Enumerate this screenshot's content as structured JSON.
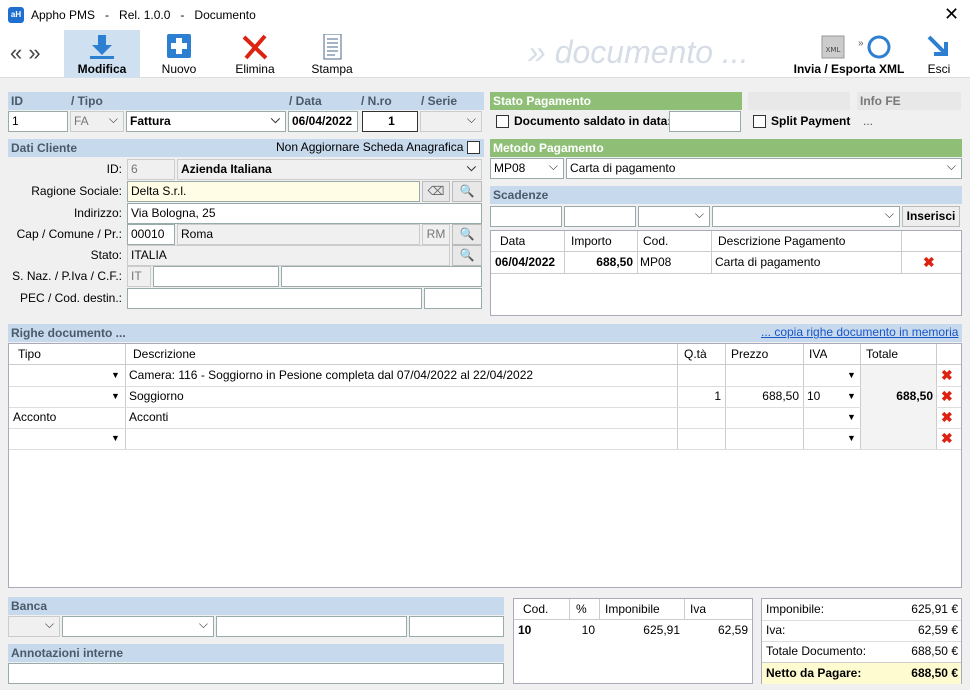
{
  "window": {
    "app": "Appho PMS",
    "release": "Rel. 1.0.0",
    "section": "Documento",
    "app_icon": "aH"
  },
  "toolbar": {
    "modifica": "Modifica",
    "nuovo": "Nuovo",
    "elimina": "Elimina",
    "stampa": "Stampa",
    "invia": "Invia / Esporta XML",
    "esci": "Esci",
    "watermark": "» documento ...",
    "xml_badge": "XML"
  },
  "doc": {
    "id_label": "ID",
    "tipo_label": "/ Tipo",
    "data_label": "/ Data",
    "nro_label": "/ N.ro",
    "serie_label": "/ Serie",
    "id": "1",
    "tipo_code": "FA",
    "tipo": "Fattura",
    "data": "06/04/2022",
    "nro": "1",
    "serie": ""
  },
  "cliente": {
    "title": "Dati Cliente",
    "no_update": "Non Aggiornare Scheda Anagrafica",
    "id_label": "ID:",
    "id": "6",
    "tipo": "Azienda Italiana",
    "ragione_label": "Ragione Sociale:",
    "ragione": "Delta S.r.l.",
    "indirizzo_label": "Indirizzo:",
    "indirizzo": "Via Bologna, 25",
    "cap_label": "Cap / Comune / Pr.:",
    "cap": "00010",
    "comune": "Roma",
    "pr": "RM",
    "stato_label": "Stato:",
    "stato": "ITALIA",
    "naz_label": "S. Naz. / P.Iva / C.F.:",
    "naz": "IT",
    "piva": "",
    "cf": "",
    "pec_label": "PEC / Cod. destin.:",
    "pec": "",
    "cod_dest": ""
  },
  "pagamento": {
    "stato_title": "Stato Pagamento",
    "saldato_label": "Documento saldato in data:",
    "saldato_data": "",
    "split": "Split Payment",
    "info_fe_title": "Info FE",
    "info_fe": "...",
    "metodo_title": "Metodo Pagamento",
    "metodo_code": "MP08",
    "metodo": "Carta di pagamento"
  },
  "scadenze": {
    "title": "Scadenze",
    "inserisci": "Inserisci",
    "headers": [
      "Data",
      "Importo",
      "Cod.",
      "Descrizione Pagamento"
    ],
    "rows": [
      {
        "data": "06/04/2022",
        "importo": "688,50",
        "cod": "MP08",
        "desc": "Carta di pagamento"
      }
    ]
  },
  "righe": {
    "title": "Righe documento ...",
    "copy_link": "... copia righe documento in memoria",
    "headers": [
      "Tipo",
      "Descrizione",
      "Q.tà",
      "Prezzo",
      "IVA",
      "Totale"
    ],
    "rows": [
      {
        "tipo": "",
        "desc": "Camera: 116 - Soggiorno in Pesione completa dal 07/04/2022 al 22/04/2022",
        "qta": "",
        "prezzo": "",
        "iva": "",
        "totale": ""
      },
      {
        "tipo": "",
        "desc": "Soggiorno",
        "qta": "1",
        "prezzo": "688,50",
        "iva": "10",
        "totale": "688,50"
      },
      {
        "tipo": "Acconto",
        "desc": "Acconti",
        "qta": "",
        "prezzo": "",
        "iva": "",
        "totale": ""
      },
      {
        "tipo": "",
        "desc": "",
        "qta": "",
        "prezzo": "",
        "iva": "",
        "totale": ""
      }
    ]
  },
  "banca": {
    "title": "Banca",
    "annotazioni_title": "Annotazioni interne"
  },
  "iva_table": {
    "headers": [
      "Cod.",
      "%",
      "Imponibile",
      "Iva"
    ],
    "rows": [
      {
        "cod": "10",
        "perc": "10",
        "imponibile": "625,91",
        "iva": "62,59"
      }
    ]
  },
  "totali": {
    "imponibile_label": "Imponibile:",
    "imponibile": "625,91 €",
    "iva_label": "Iva:",
    "iva": "62,59 €",
    "totale_label": "Totale Documento:",
    "totale": "688,50 €",
    "netto_label": "Netto da Pagare:",
    "netto": "688,50 €"
  }
}
